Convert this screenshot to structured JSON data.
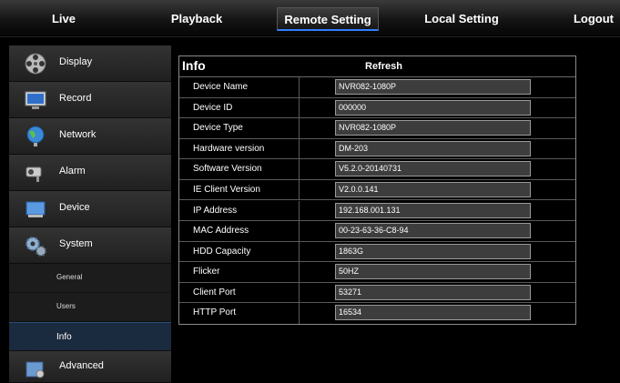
{
  "nav": {
    "live": "Live",
    "playback": "Playback",
    "remote_setting": "Remote Setting",
    "local_setting": "Local Setting",
    "logout": "Logout"
  },
  "sidebar": {
    "display": "Display",
    "record": "Record",
    "network": "Network",
    "alarm": "Alarm",
    "device": "Device",
    "system": "System",
    "general": "General",
    "users": "Users",
    "info": "Info",
    "advanced": "Advanced"
  },
  "panel": {
    "title": "Info",
    "refresh": "Refresh",
    "rows": [
      {
        "label": "Device Name",
        "value": "NVR082-1080P"
      },
      {
        "label": "Device ID",
        "value": "000000"
      },
      {
        "label": "Device Type",
        "value": "NVR082-1080P"
      },
      {
        "label": "Hardware version",
        "value": "DM-203"
      },
      {
        "label": "Software Version",
        "value": "V5.2.0-20140731"
      },
      {
        "label": "IE Client Version",
        "value": "V2.0.0.141"
      },
      {
        "label": "IP Address",
        "value": "192.168.001.131"
      },
      {
        "label": "MAC Address",
        "value": "00-23-63-36-C8-94"
      },
      {
        "label": "HDD Capacity",
        "value": "1863G"
      },
      {
        "label": "Flicker",
        "value": "50HZ"
      },
      {
        "label": "Client Port",
        "value": "53271"
      },
      {
        "label": "HTTP Port",
        "value": "16534"
      }
    ]
  },
  "colors": {
    "accent": "#2f7fff",
    "selected_bg": "#1a2a3f"
  }
}
